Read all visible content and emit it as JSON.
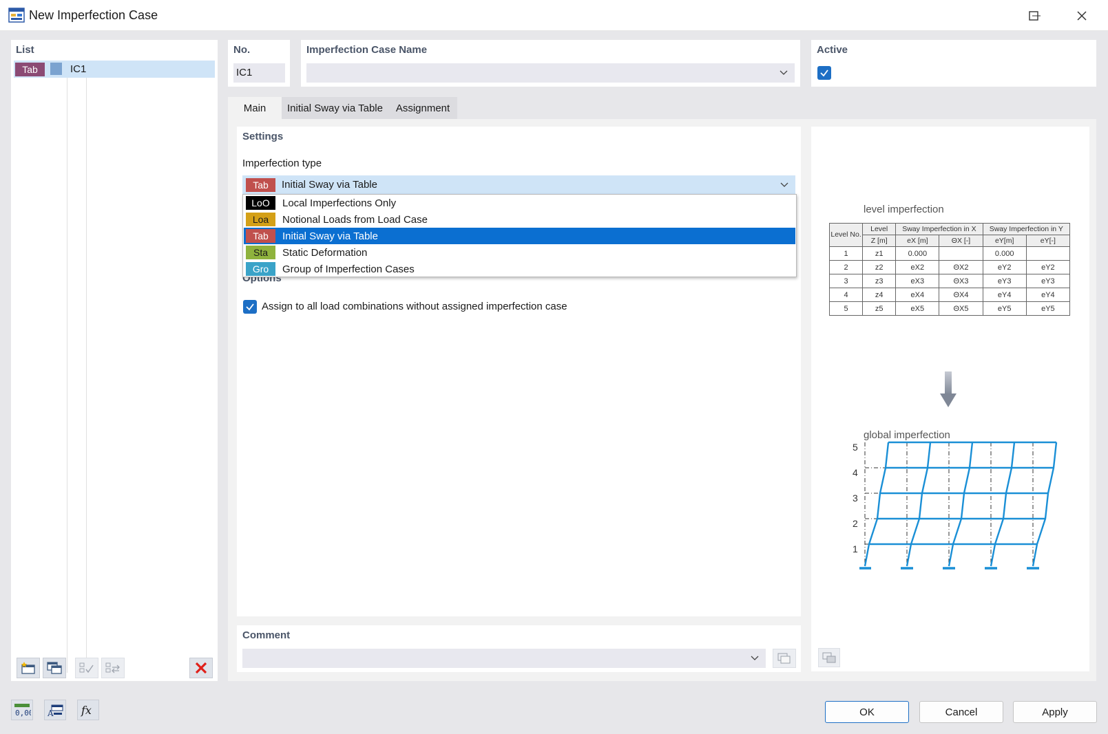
{
  "window": {
    "title": "New Imperfection Case",
    "minimize_icon": "minimize-icon",
    "maximize_icon": "maximize-icon",
    "close_icon": "close-icon"
  },
  "list": {
    "title": "List",
    "items": [
      {
        "badge": "Tab",
        "badge_color": "#8b4a74",
        "label": "IC1"
      }
    ]
  },
  "number": {
    "title": "No.",
    "value": "IC1"
  },
  "name": {
    "title": "Imperfection Case Name",
    "value": "",
    "placeholder": ""
  },
  "active": {
    "title": "Active",
    "checked": true
  },
  "tabs": [
    {
      "label": "Main",
      "active": true
    },
    {
      "label": "Initial Sway via Table",
      "active": false
    },
    {
      "label": "Assignment",
      "active": false
    }
  ],
  "settings": {
    "title": "Settings",
    "type_label": "Imperfection type",
    "selected": {
      "badge": "Tab",
      "label": "Initial Sway via Table",
      "color": "#c0504d"
    },
    "options": [
      {
        "badge": "LoO",
        "label": "Local Imperfections Only",
        "color": "#000000"
      },
      {
        "badge": "Loa",
        "label": "Notional Loads from Load Case",
        "color": "#d4a017"
      },
      {
        "badge": "Tab",
        "label": "Initial Sway via Table",
        "color": "#c0504d",
        "highlighted": true
      },
      {
        "badge": "Sta",
        "label": "Static Deformation",
        "color": "#8fb33d"
      },
      {
        "badge": "Gro",
        "label": "Group of Imperfection Cases",
        "color": "#3aa3c8"
      }
    ]
  },
  "options": {
    "title": "Options",
    "assign_all_label": "Assign to all load combinations without assigned imperfection case",
    "assign_all_checked": true
  },
  "comment": {
    "title": "Comment",
    "value": ""
  },
  "diagram": {
    "level_title": "level imperfection",
    "global_title": "global imperfection",
    "table_header": [
      "Level No.",
      "Level",
      "Sway Imperfection in X",
      "Sway Imperfection in Y"
    ],
    "table_subheader": [
      "Z [m]",
      "eX [m]",
      "ΘX [-]",
      "eY[m]",
      "eY[-]"
    ],
    "table_rows": [
      [
        "1",
        "z1",
        "0.000",
        "",
        "0.000",
        ""
      ],
      [
        "2",
        "z2",
        "eX2",
        "ΘX2",
        "eY2",
        "eY2"
      ],
      [
        "3",
        "z3",
        "eX3",
        "ΘX3",
        "eY3",
        "eY3"
      ],
      [
        "4",
        "z4",
        "eX4",
        "ΘX4",
        "eY4",
        "eY4"
      ],
      [
        "5",
        "z5",
        "eX5",
        "ΘX5",
        "eY5",
        "eY5"
      ]
    ],
    "level_numbers": [
      "5",
      "4",
      "3",
      "2",
      "1"
    ]
  },
  "buttons": {
    "ok": "OK",
    "cancel": "Cancel",
    "apply": "Apply"
  },
  "colors": {
    "accent": "#1d6fc5",
    "selection": "#cfe4f7",
    "highlight": "#0b6fd1",
    "frame_blue": "#1a8fd6",
    "group_title": "#4a5568",
    "delete_red": "#e0201a"
  }
}
